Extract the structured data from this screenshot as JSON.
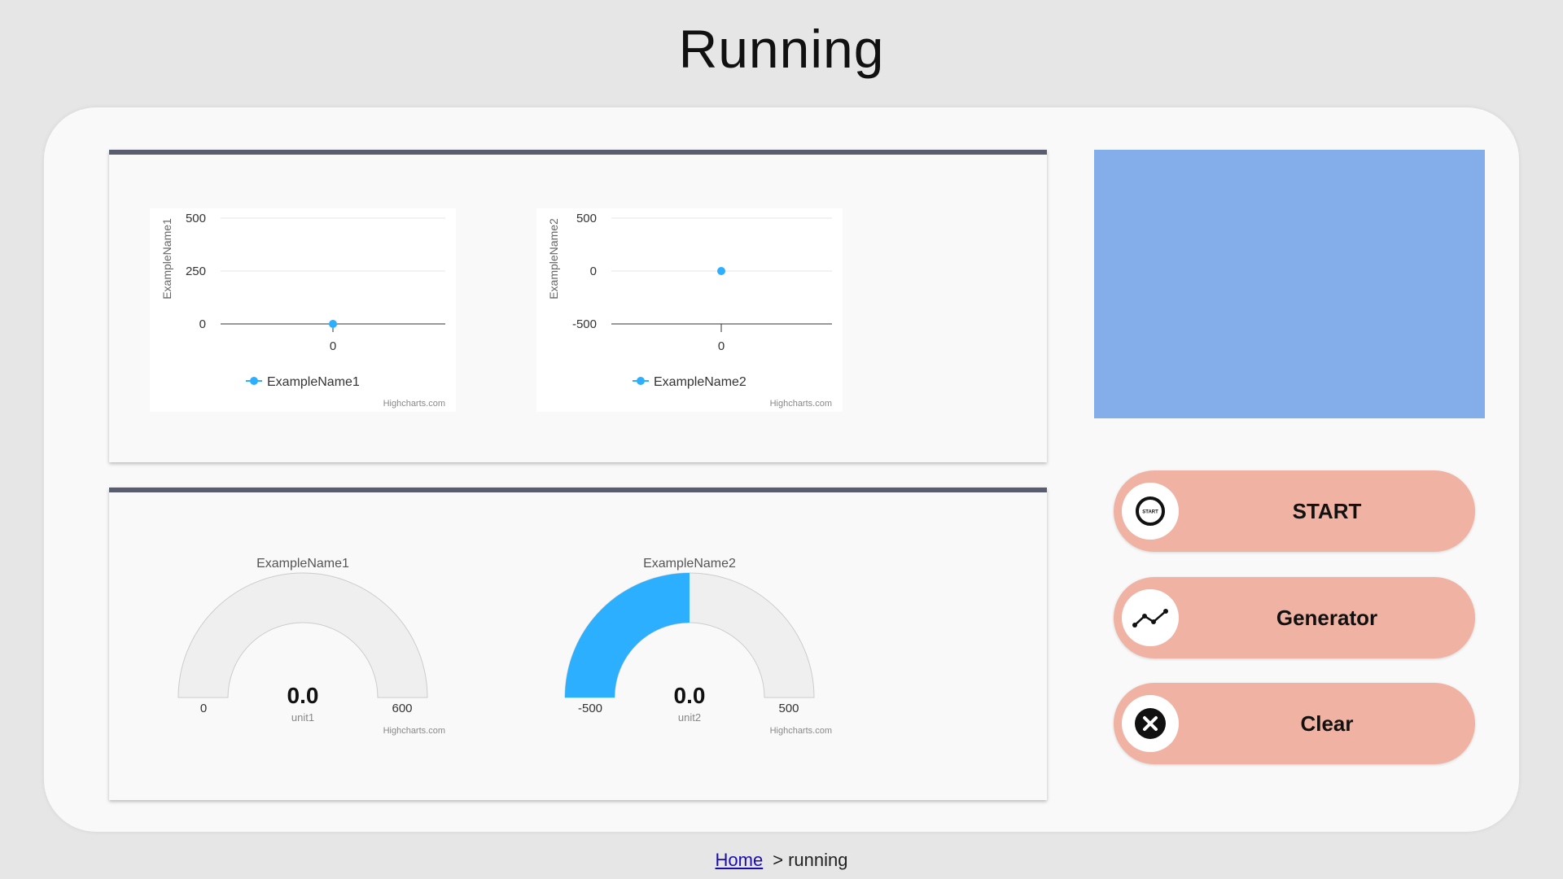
{
  "page": {
    "title": "Running"
  },
  "line_charts": [
    {
      "y_axis_title": "ExampleName1",
      "y_ticks": [
        "500",
        "250",
        "0"
      ],
      "x_ticks": [
        "0"
      ],
      "legend": "ExampleName1",
      "credit": "Highcharts.com",
      "color": "#2caffe"
    },
    {
      "y_axis_title": "ExampleName2",
      "y_ticks": [
        "500",
        "0",
        "-500"
      ],
      "x_ticks": [
        "0"
      ],
      "legend": "ExampleName2",
      "credit": "Highcharts.com",
      "color": "#2caffe"
    }
  ],
  "gauges": [
    {
      "title": "ExampleName1",
      "min": "0",
      "max": "600",
      "value": "0.0",
      "unit": "unit1",
      "credit": "Highcharts.com",
      "fill_fraction": 0
    },
    {
      "title": "ExampleName2",
      "min": "-500",
      "max": "500",
      "value": "0.0",
      "unit": "unit2",
      "credit": "Highcharts.com",
      "fill_fraction": 0.5
    }
  ],
  "buttons": {
    "start": {
      "label": "START",
      "icon_text": "START",
      "icon": "start-icon"
    },
    "generator": {
      "label": "Generator",
      "icon": "line-chart-icon"
    },
    "clear": {
      "label": "Clear",
      "icon": "close-icon"
    }
  },
  "breadcrumb": {
    "home": "Home",
    "separator": ">",
    "current": "running"
  },
  "colors": {
    "accent": "#2caffe",
    "button_bg": "#f0b3a3",
    "preview_bg": "#84aeea",
    "card_border": "#5a5c70"
  },
  "chart_data": [
    {
      "type": "line",
      "ylabel": "ExampleName1",
      "ylim": [
        0,
        500
      ],
      "series": [
        {
          "name": "ExampleName1",
          "x": [
            0
          ],
          "values": [
            0
          ]
        }
      ]
    },
    {
      "type": "line",
      "ylabel": "ExampleName2",
      "ylim": [
        -500,
        500
      ],
      "series": [
        {
          "name": "ExampleName2",
          "x": [
            0
          ],
          "values": [
            0
          ]
        }
      ]
    }
  ]
}
